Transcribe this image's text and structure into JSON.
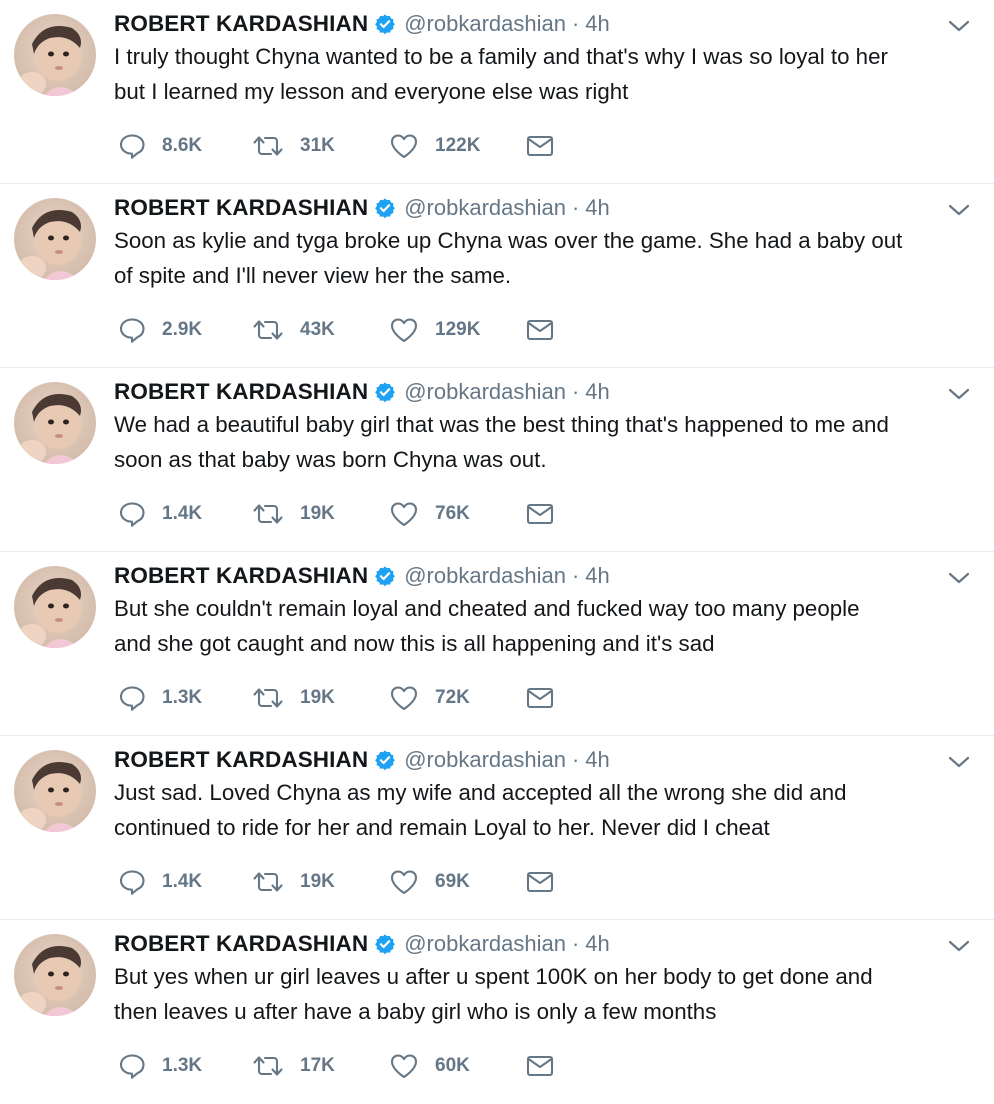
{
  "tweets": [
    {
      "name": "ROBERT KARDASHIAN",
      "handle": "@robkardashian",
      "separator": "·",
      "time": "4h",
      "text": "I truly thought Chyna wanted to be a family and that's why I was so loyal to her\nbut I learned my lesson and everyone else was right",
      "replies": "8.6K",
      "retweets": "31K",
      "likes": "122K"
    },
    {
      "name": "ROBERT KARDASHIAN",
      "handle": "@robkardashian",
      "separator": "·",
      "time": "4h",
      "text": "Soon as kylie and tyga broke up Chyna was over the game. She had a baby out\nof spite and I'll never view her the same.",
      "replies": "2.9K",
      "retweets": "43K",
      "likes": "129K"
    },
    {
      "name": "ROBERT KARDASHIAN",
      "handle": "@robkardashian",
      "separator": "·",
      "time": "4h",
      "text": "We had a beautiful baby girl that was the best thing that's happened to me and\nsoon as that baby was born Chyna was out.",
      "replies": "1.4K",
      "retweets": "19K",
      "likes": "76K"
    },
    {
      "name": "ROBERT KARDASHIAN",
      "handle": "@robkardashian",
      "separator": "·",
      "time": "4h",
      "text": "But she couldn't remain loyal and cheated and fucked way too many people\nand she got caught and now this is all happening and it's sad",
      "replies": "1.3K",
      "retweets": "19K",
      "likes": "72K"
    },
    {
      "name": "ROBERT KARDASHIAN",
      "handle": "@robkardashian",
      "separator": "·",
      "time": "4h",
      "text": "Just sad. Loved Chyna as my wife and accepted all the wrong she did and\ncontinued to ride for her and remain Loyal to her. Never did I cheat",
      "replies": "1.4K",
      "retweets": "19K",
      "likes": "69K"
    },
    {
      "name": "ROBERT KARDASHIAN",
      "handle": "@robkardashian",
      "separator": "·",
      "time": "4h",
      "text": "But yes when ur girl leaves u after u spent 100K on her body to get done and\nthen leaves u after have a baby girl who is only a few months",
      "replies": "1.3K",
      "retweets": "17K",
      "likes": "60K"
    }
  ],
  "icons": {
    "verified": "verified-badge-icon",
    "caret": "chevron-down-icon",
    "reply": "reply-icon",
    "retweet": "retweet-icon",
    "like": "heart-icon",
    "dm": "envelope-icon"
  },
  "colors": {
    "text": "#14171a",
    "muted": "#657786",
    "verified": "#1da1f2",
    "divider": "#e6ecf0"
  }
}
